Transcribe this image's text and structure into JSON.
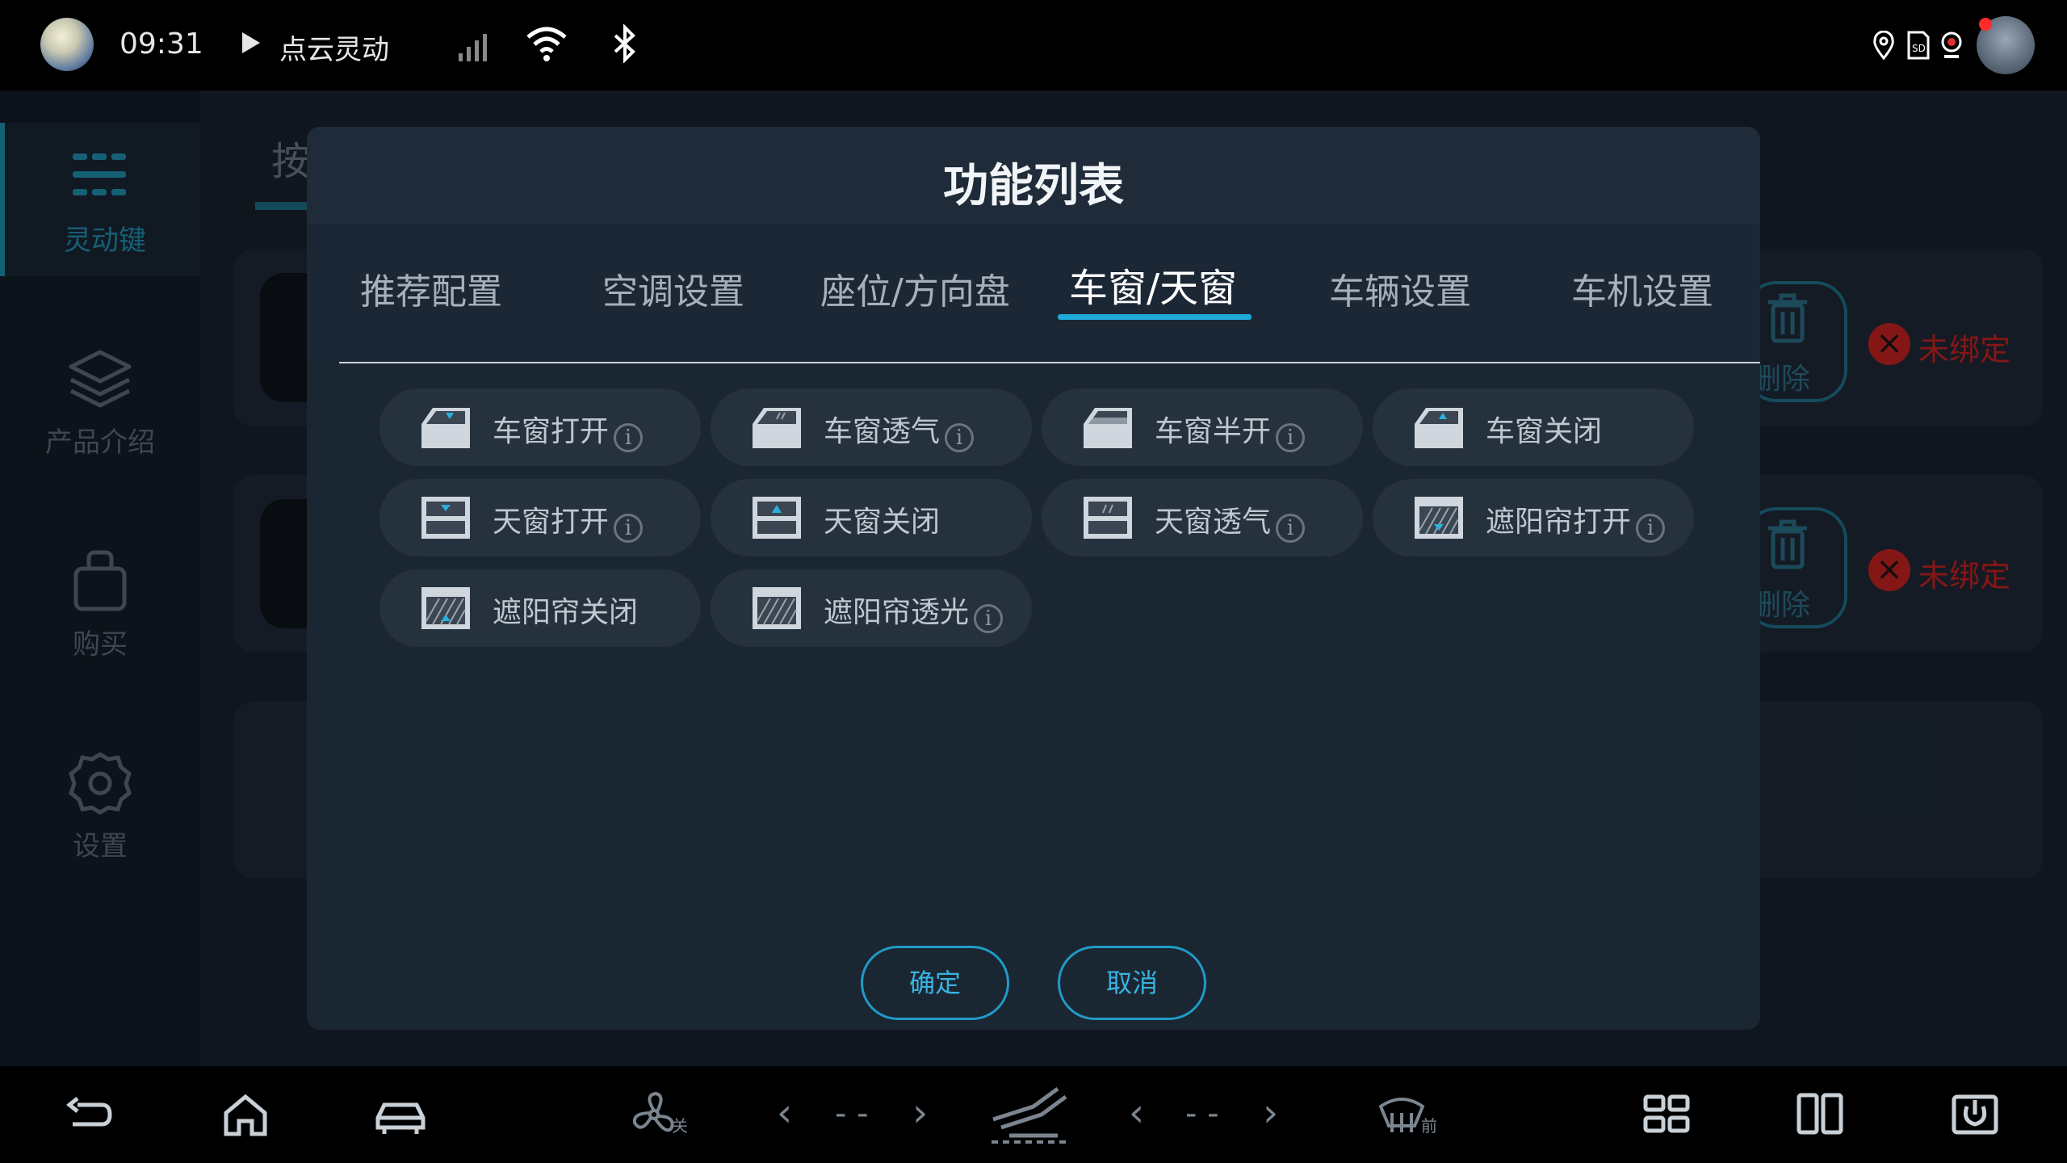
{
  "status_bar": {
    "time": "09:31",
    "now_playing": "点云灵动",
    "icons": [
      "signal-icon",
      "wifi-icon",
      "bluetooth-icon",
      "location-icon",
      "sd-card-icon",
      "camera-icon"
    ]
  },
  "sidebar": {
    "items": [
      {
        "label": "灵动键",
        "icon": "buttons-grid-icon",
        "active": true
      },
      {
        "label": "产品介绍",
        "icon": "layers-icon",
        "active": false
      },
      {
        "label": "购买",
        "icon": "shopping-bag-icon",
        "active": false
      },
      {
        "label": "设置",
        "icon": "gear-icon",
        "active": false
      }
    ]
  },
  "background": {
    "tab_label": "按",
    "cards": [
      {
        "delete_label": "删除",
        "status": "未绑定"
      },
      {
        "delete_label": "删除",
        "status": "未绑定"
      }
    ]
  },
  "dialog": {
    "title": "功能列表",
    "tabs": [
      {
        "label": "推荐配置"
      },
      {
        "label": "空调设置"
      },
      {
        "label": "座位/方向盘"
      },
      {
        "label": "车窗/天窗",
        "active": true
      },
      {
        "label": "车辆设置"
      },
      {
        "label": "车机设置"
      }
    ],
    "functions": [
      {
        "label": "车窗打开",
        "info": true,
        "icon": "car-window-open-icon"
      },
      {
        "label": "车窗透气",
        "info": true,
        "icon": "car-window-vent-icon"
      },
      {
        "label": "车窗半开",
        "info": true,
        "icon": "car-window-half-icon"
      },
      {
        "label": "车窗关闭",
        "info": false,
        "icon": "car-window-close-icon"
      },
      {
        "label": "天窗打开",
        "info": true,
        "icon": "sunroof-open-icon"
      },
      {
        "label": "天窗关闭",
        "info": false,
        "icon": "sunroof-close-icon"
      },
      {
        "label": "天窗透气",
        "info": true,
        "icon": "sunroof-vent-icon"
      },
      {
        "label": "遮阳帘打开",
        "info": true,
        "icon": "sunshade-open-icon"
      },
      {
        "label": "遮阳帘关闭",
        "info": false,
        "icon": "sunshade-close-icon"
      },
      {
        "label": "遮阳帘透光",
        "info": true,
        "icon": "sunshade-light-icon"
      }
    ],
    "info_glyph": "i",
    "confirm_label": "确定",
    "cancel_label": "取消"
  },
  "dock": {
    "fan_label": "关",
    "left_temp": "- -",
    "right_temp": "- -",
    "defrost_label": "前",
    "icons": [
      "back-icon",
      "home-icon",
      "car-icon",
      "fan-icon",
      "seat-heat-icon",
      "defrost-icon",
      "apps-icon",
      "split-screen-icon",
      "power-icon"
    ]
  },
  "colors": {
    "accent": "#1fa9d6",
    "warning": "#c8201d",
    "dialog_bg": "#1b2633"
  }
}
